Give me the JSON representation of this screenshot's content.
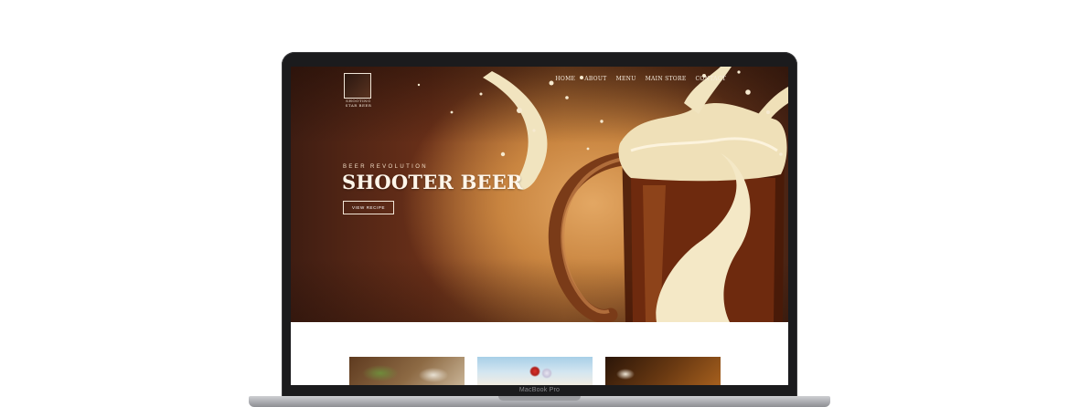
{
  "device": {
    "model_label": "MacBook Pro"
  },
  "site": {
    "logo": {
      "text": "SHOOTING\nSTAR BEER"
    },
    "nav": {
      "items": [
        {
          "label": "Home"
        },
        {
          "label": "About"
        },
        {
          "label": "Menu"
        },
        {
          "label": "Main Store"
        },
        {
          "label": "Contact"
        }
      ]
    },
    "hero": {
      "eyebrow": "Beer Revolution",
      "title": "SHOOTER BEER",
      "cta_label": "View Recipe"
    }
  },
  "colors": {
    "hero_dark": "#3f1d12",
    "hero_mid": "#a4602d",
    "foam": "#f1e4bf",
    "text_light": "#fff6ea"
  }
}
